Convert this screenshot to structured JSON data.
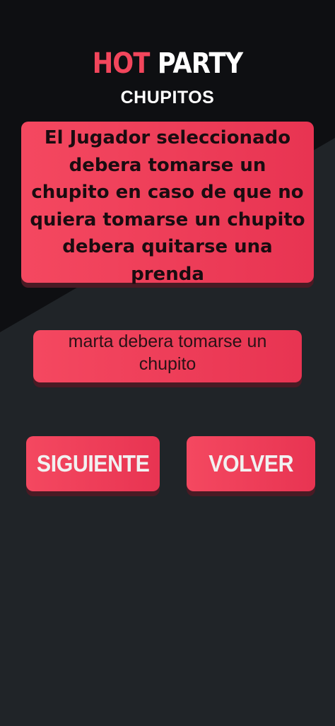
{
  "header": {
    "title_hot": "HOT",
    "title_party": "PARTY",
    "subtitle": "CHUPITOS"
  },
  "rule_card": {
    "text": "El Jugador seleccionado debera tomarse un chupito en caso de que no quiera tomarse un chupito debera quitarse una prenda"
  },
  "result_card": {
    "text": "marta debera tomarse un chupito"
  },
  "buttons": {
    "next_label": "SIGUIENTE",
    "back_label": "VOLVER"
  },
  "colors": {
    "accent": "#f2465c",
    "background_dark": "#0e0f12",
    "background": "#202428"
  }
}
